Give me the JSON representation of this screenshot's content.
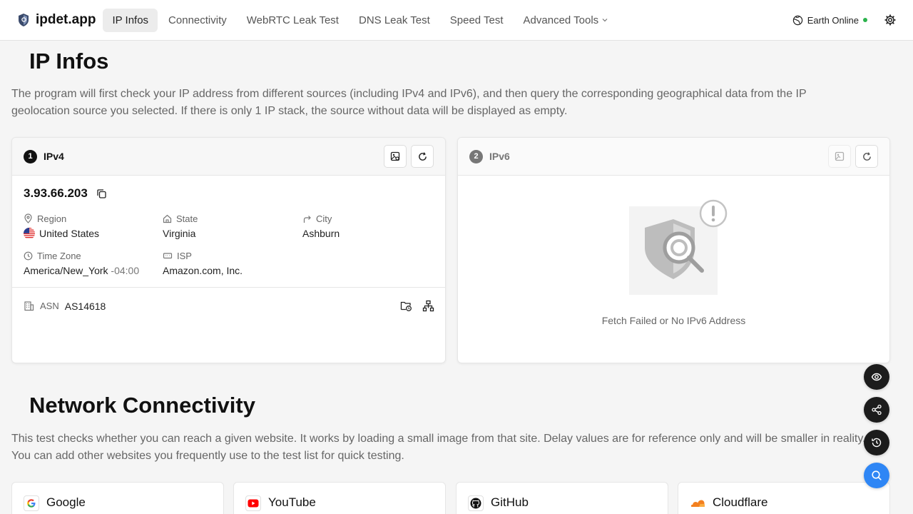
{
  "header": {
    "brand": "ipdet.app",
    "nav": [
      {
        "label": "IP Infos",
        "active": true
      },
      {
        "label": "Connectivity"
      },
      {
        "label": "WebRTC Leak Test"
      },
      {
        "label": "DNS Leak Test"
      },
      {
        "label": "Speed Test"
      },
      {
        "label": "Advanced Tools",
        "dropdown": true
      }
    ],
    "status": "Earth Online",
    "status_color": "#2bb24c"
  },
  "ip_infos": {
    "title": "IP Infos",
    "description": "The program will first check your IP address from different sources (including IPv4 and IPv6), and then query the corresponding geographical data from the IP geolocation source you selected. If there is only 1 IP stack, the source without data will be displayed as empty.",
    "ipv4": {
      "number": "1",
      "label": "IPv4",
      "ip": "3.93.66.203",
      "region_label": "Region",
      "region": "United States",
      "state_label": "State",
      "state": "Virginia",
      "city_label": "City",
      "city": "Ashburn",
      "timezone_label": "Time Zone",
      "timezone": "America/New_York",
      "timezone_offset": "-04:00",
      "isp_label": "ISP",
      "isp": "Amazon.com, Inc.",
      "asn_label": "ASN",
      "asn": "AS14618"
    },
    "ipv6": {
      "number": "2",
      "label": "IPv6",
      "message": "Fetch Failed or No IPv6 Address"
    }
  },
  "connectivity": {
    "title": "Network Connectivity",
    "description": "This test checks whether you can reach a given website. It works by loading a small image from that site. Delay values are for reference only and will be smaller in reality. You can add other websites you frequently use to the test list for quick testing.",
    "sites": [
      {
        "name": "Google"
      },
      {
        "name": "YouTube"
      },
      {
        "name": "GitHub"
      },
      {
        "name": "Cloudflare"
      }
    ]
  },
  "colors": {
    "accent_blue": "#2e86f5",
    "dark": "#1c1c1c",
    "youtube_red": "#ff0000",
    "cloudflare_orange": "#f38020"
  }
}
